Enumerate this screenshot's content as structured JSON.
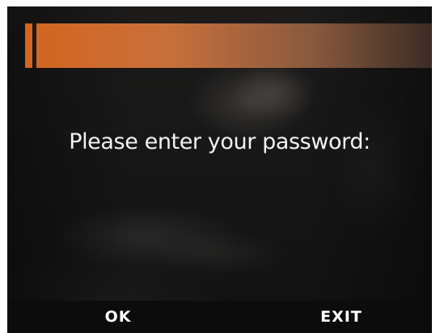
{
  "screen": {
    "prompt_text": "Please enter your password:"
  },
  "softkeys": {
    "ok_label": "OK",
    "exit_label": "EXIT"
  },
  "colors": {
    "title_bar_accent": "#d4651f",
    "background": "#141414",
    "text": "#f2f2f2"
  }
}
